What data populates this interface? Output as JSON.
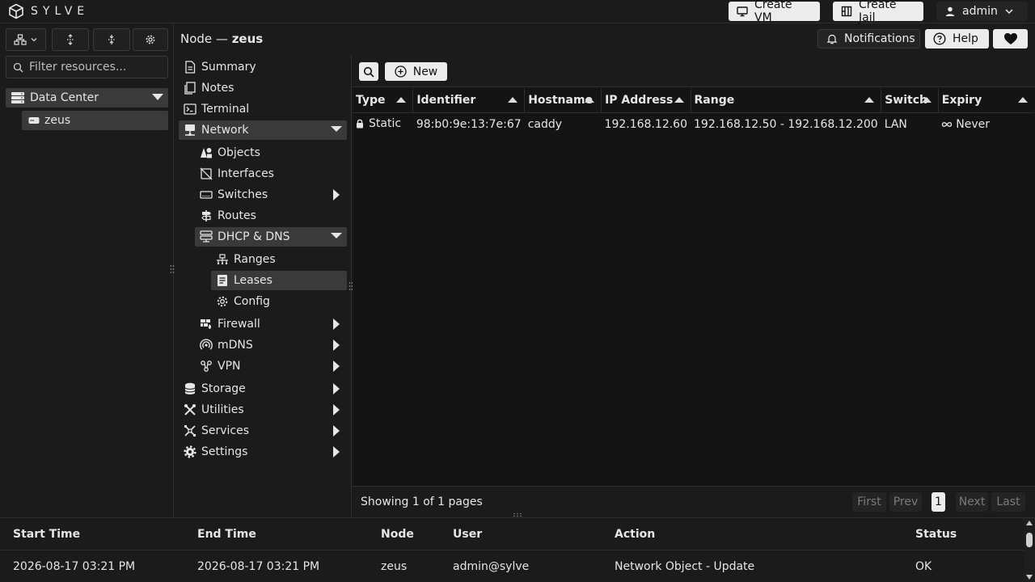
{
  "app": {
    "brand": "SYLVE"
  },
  "topbar": {
    "create_vm": "Create VM",
    "create_jail": "Create Jail",
    "user": "admin"
  },
  "left": {
    "filter_placeholder": "Filter resources...",
    "datacenter": "Data Center",
    "node": "zeus"
  },
  "breadcrumb": {
    "prefix": "Node — ",
    "node": "zeus"
  },
  "header_actions": {
    "notifications": "Notifications",
    "help": "Help"
  },
  "nav": {
    "summary": "Summary",
    "notes": "Notes",
    "terminal": "Terminal",
    "network": "Network",
    "objects": "Objects",
    "interfaces": "Interfaces",
    "switches": "Switches",
    "routes": "Routes",
    "dhcp_dns": "DHCP & DNS",
    "ranges": "Ranges",
    "leases": "Leases",
    "config": "Config",
    "firewall": "Firewall",
    "mdns": "mDNS",
    "vpn": "VPN",
    "storage": "Storage",
    "utilities": "Utilities",
    "services": "Services",
    "settings": "Settings"
  },
  "toolbar": {
    "new_label": "New"
  },
  "table": {
    "columns": [
      "Type",
      "Identifier",
      "Hostname",
      "IP Address",
      "Range",
      "Switch",
      "Expiry"
    ],
    "rows": [
      {
        "type": "Static",
        "identifier": "98:b0:9e:13:7e:67",
        "hostname": "caddy",
        "ip": "192.168.12.60",
        "range": "192.168.12.50 - 192.168.12.200",
        "switch": "LAN",
        "expiry": "Never"
      }
    ]
  },
  "pagination": {
    "summary": "Showing 1 of 1 pages",
    "first": "First",
    "prev": "Prev",
    "current": "1",
    "next": "Next",
    "last": "Last"
  },
  "log": {
    "columns": [
      "Start Time",
      "End Time",
      "Node",
      "User",
      "Action",
      "Status"
    ],
    "rows": [
      {
        "start": "2026-08-17 03:21 PM",
        "end": "2026-08-17 03:21 PM",
        "node": "zeus",
        "user": "admin@sylve",
        "action": "Network Object - Update",
        "status": "OK"
      }
    ]
  },
  "colors": {
    "background": "#1b1b1b",
    "content": "#141414",
    "selected": "#3a3a3a",
    "light_button": "#ececec"
  }
}
